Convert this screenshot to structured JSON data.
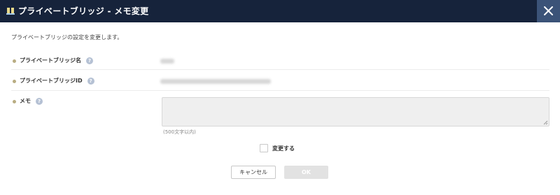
{
  "dialog": {
    "title": "プライベートブリッジ - メモ変更",
    "close_icon": "close-icon"
  },
  "description": "プライベートブリッジの設定を変更します。",
  "fields": {
    "name": {
      "label": "プライベートブリッジ名",
      "value": ""
    },
    "id": {
      "label": "プライベートブリッジID",
      "value": ""
    },
    "memo": {
      "label": "メモ",
      "value": "",
      "placeholder": "",
      "limit_note": "(500文字以内)"
    }
  },
  "change_checkbox": {
    "label": "変更する",
    "checked": false
  },
  "buttons": {
    "cancel": "キャンセル",
    "ok": "OK"
  },
  "colors": {
    "titlebar": "#16233b",
    "close_button": "#3b5378",
    "bullet": "#b9ad83",
    "help_icon": "#b5c1d4",
    "ok_disabled": "#e2e2e2"
  }
}
